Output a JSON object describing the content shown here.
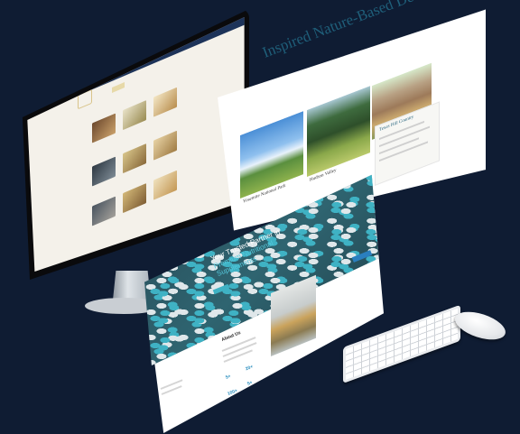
{
  "destinations_page": {
    "title": "Inspired Nature-Based Destinations",
    "cards": [
      {
        "caption": "Yosemite National Park"
      },
      {
        "caption": "Hudson Valley"
      }
    ],
    "info_box_title": "Texas Hill Country"
  },
  "supplements_page": {
    "hero_line1": "Your Trusted Partner in",
    "hero_line2": "Premium Nutritional",
    "hero_line3": "Supplements",
    "about_title": "About Us",
    "stats": [
      "5+",
      "20+",
      "100+",
      "5+"
    ]
  },
  "colors": {
    "background": "#0f1c33",
    "accent_teal": "#3fb2c4",
    "navy": "#1d3359",
    "title_blue": "#1f5f7a"
  }
}
